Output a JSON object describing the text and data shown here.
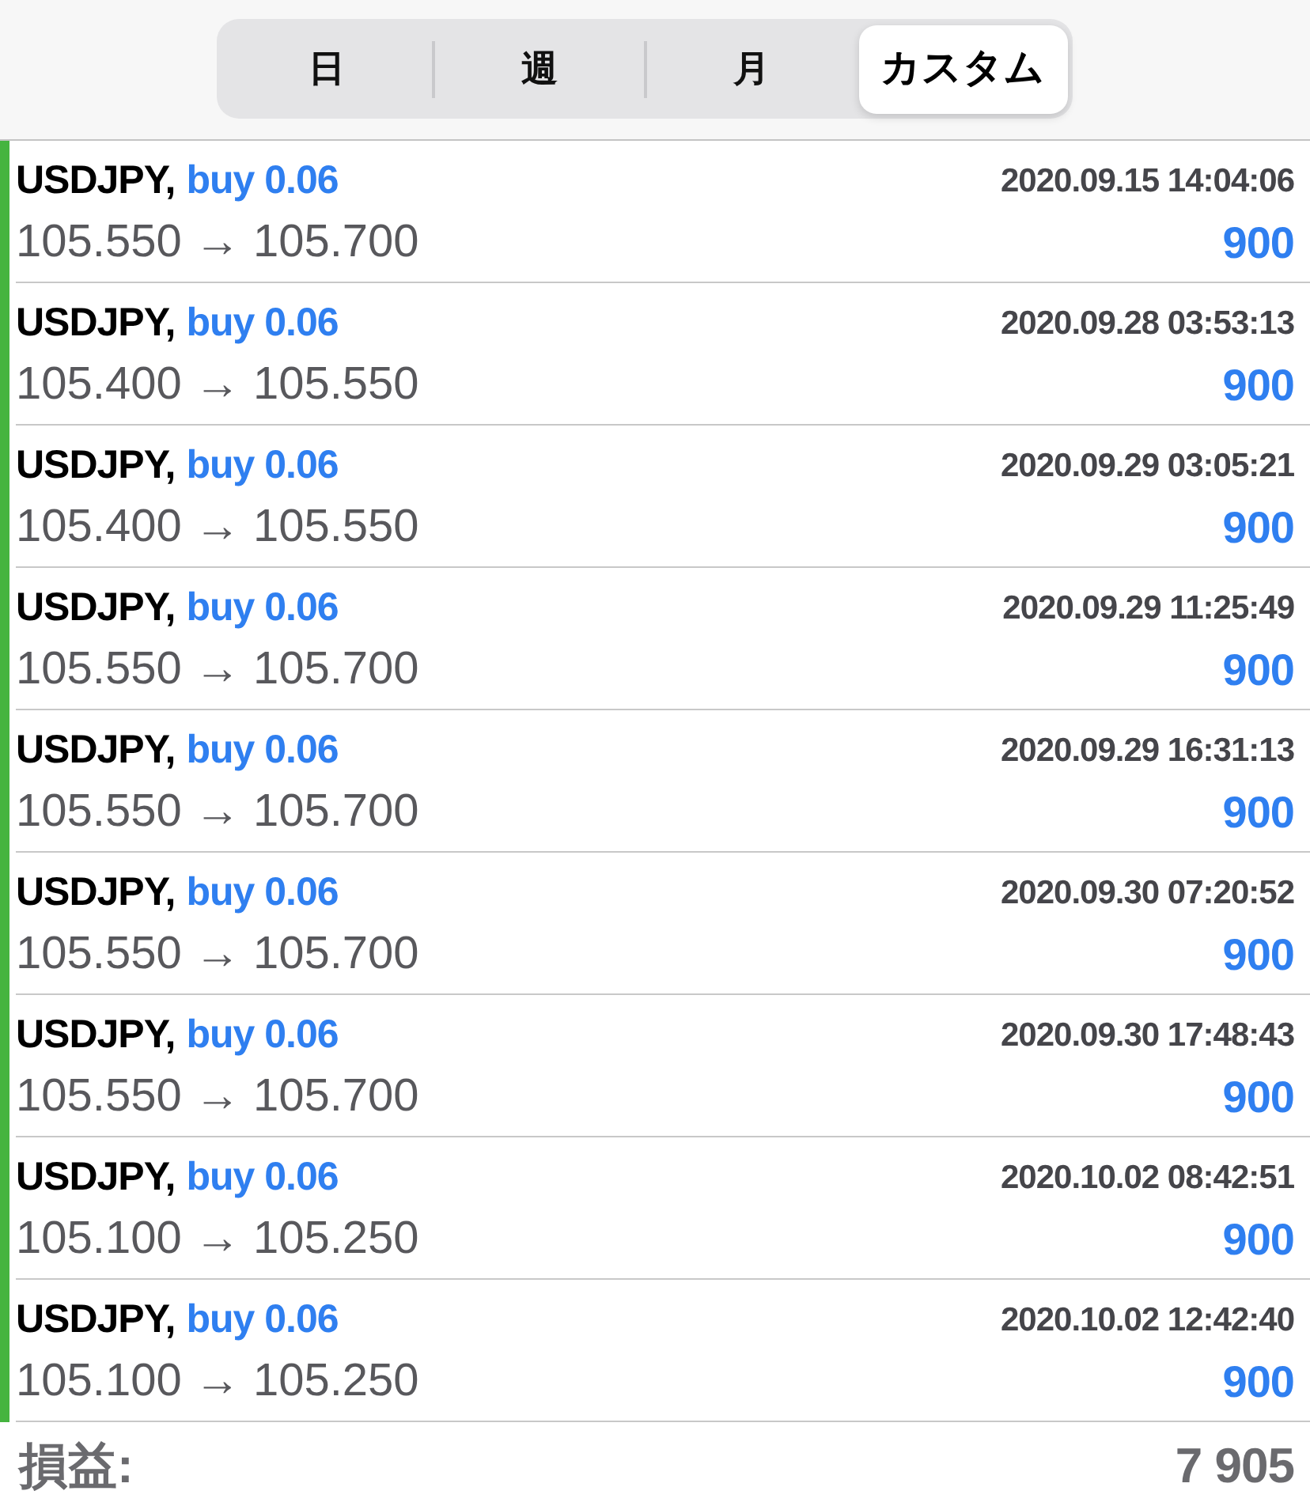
{
  "period_tabs": [
    {
      "label": "日",
      "selected": false
    },
    {
      "label": "週",
      "selected": false
    },
    {
      "label": "月",
      "selected": false
    },
    {
      "label": "カスタム",
      "selected": true
    }
  ],
  "trades": [
    {
      "symbol": "USDJPY,",
      "order": "buy 0.06",
      "prices": "105.550 → 105.700",
      "time": "2020.09.15 14:04:06",
      "profit": "900"
    },
    {
      "symbol": "USDJPY,",
      "order": "buy 0.06",
      "prices": "105.400 → 105.550",
      "time": "2020.09.28 03:53:13",
      "profit": "900"
    },
    {
      "symbol": "USDJPY,",
      "order": "buy 0.06",
      "prices": "105.400 → 105.550",
      "time": "2020.09.29 03:05:21",
      "profit": "900"
    },
    {
      "symbol": "USDJPY,",
      "order": "buy 0.06",
      "prices": "105.550 → 105.700",
      "time": "2020.09.29 11:25:49",
      "profit": "900"
    },
    {
      "symbol": "USDJPY,",
      "order": "buy 0.06",
      "prices": "105.550 → 105.700",
      "time": "2020.09.29 16:31:13",
      "profit": "900"
    },
    {
      "symbol": "USDJPY,",
      "order": "buy 0.06",
      "prices": "105.550 → 105.700",
      "time": "2020.09.30 07:20:52",
      "profit": "900"
    },
    {
      "symbol": "USDJPY,",
      "order": "buy 0.06",
      "prices": "105.550 → 105.700",
      "time": "2020.09.30 17:48:43",
      "profit": "900"
    },
    {
      "symbol": "USDJPY,",
      "order": "buy 0.06",
      "prices": "105.100 → 105.250",
      "time": "2020.10.02 08:42:51",
      "profit": "900"
    },
    {
      "symbol": "USDJPY,",
      "order": "buy 0.06",
      "prices": "105.100 → 105.250",
      "time": "2020.10.02 12:42:40",
      "profit": "900"
    }
  ],
  "footer": {
    "label": "損益:",
    "total": "7 905"
  }
}
